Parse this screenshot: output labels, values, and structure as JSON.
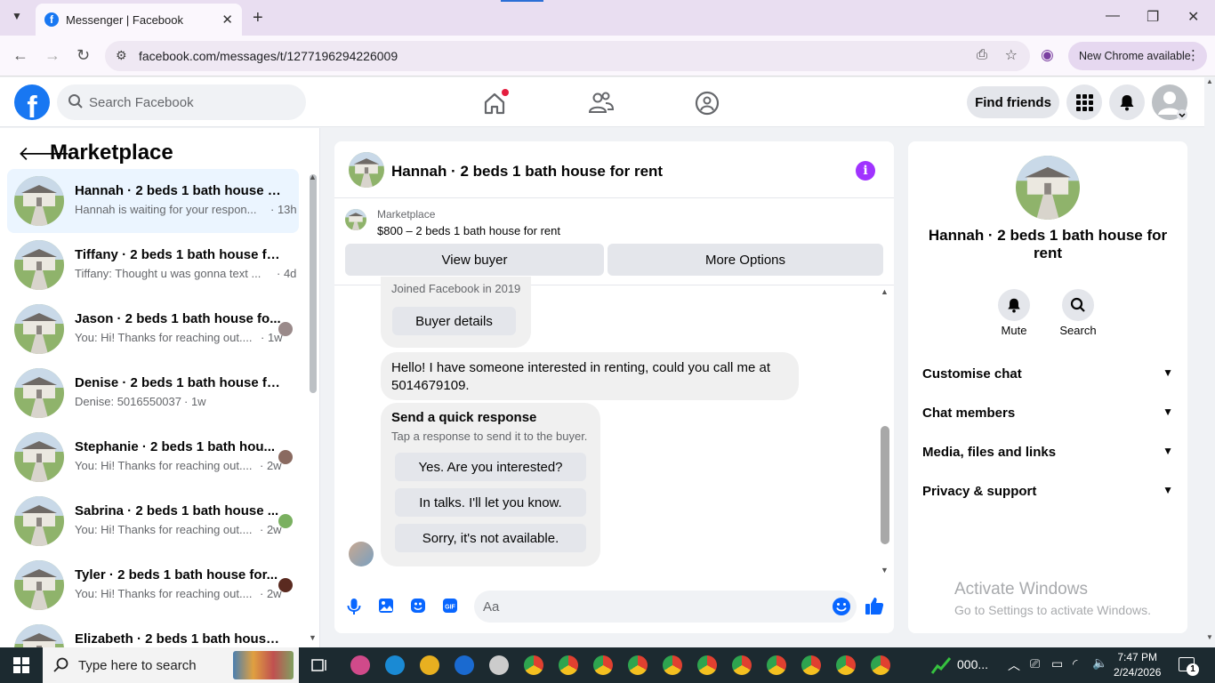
{
  "browser": {
    "tab_title": "Messenger | Facebook",
    "url": "facebook.com/messages/t/1277196294226009",
    "update_label": "New Chrome available"
  },
  "fb": {
    "search_placeholder": "Search Facebook",
    "find_friends": "Find friends"
  },
  "sidebar": {
    "title": "Marketplace",
    "conversations": [
      {
        "name": "Hannah · 2 beds 1 bath house fo...",
        "preview": "Hannah is waiting for your respon...",
        "time": "· 13h",
        "selected": true
      },
      {
        "name": "Tiffany · 2 beds 1 bath house for...",
        "preview": "Tiffany: Thought u was gonna text ...",
        "time": "· 4d"
      },
      {
        "name": "Jason · 2 beds 1 bath house fo...",
        "preview": "You: Hi! Thanks for reaching out....",
        "time": "· 1w"
      },
      {
        "name": "Denise · 2 beds 1 bath house for ...",
        "preview": "Denise: 5016550037",
        "time": "· 1w"
      },
      {
        "name": "Stephanie · 2 beds 1 bath hou...",
        "preview": "You: Hi! Thanks for reaching out....",
        "time": "· 2w"
      },
      {
        "name": "Sabrina · 2 beds 1 bath house ...",
        "preview": "You: Hi! Thanks for reaching out....",
        "time": "· 2w"
      },
      {
        "name": "Tyler · 2 beds 1 bath house for...",
        "preview": "You: Hi! Thanks for reaching out....",
        "time": "· 2w"
      },
      {
        "name": "Elizabeth · 2 beds 1 bath house f...",
        "preview": "",
        "time": ""
      }
    ]
  },
  "chat": {
    "title": "Hannah · 2 beds 1 bath house for rent",
    "marketplace_label": "Marketplace",
    "listing": "$800 – 2 beds 1 bath house for rent",
    "view_buyer": "View buyer",
    "more_options": "More Options",
    "joined": "Joined Facebook in 2019",
    "buyer_details": "Buyer details",
    "message": "Hello! I have someone interested in renting, could you call me at 5014679109.",
    "quick_title": "Send a quick response",
    "quick_sub": "Tap a response to send it to the buyer.",
    "quick_responses": [
      "Yes. Are you interested?",
      "In talks. I'll let you know.",
      "Sorry, it's not available."
    ],
    "composer_placeholder": "Aa"
  },
  "info_panel": {
    "title": "Hannah · 2 beds 1 bath house for rent",
    "mute": "Mute",
    "search": "Search",
    "sections": [
      "Customise chat",
      "Chat members",
      "Media, files and links",
      "Privacy & support"
    ]
  },
  "watermark": {
    "line1": "Activate Windows",
    "line2": "Go to Settings to activate Windows."
  },
  "taskbar": {
    "search_placeholder": "Type here to search",
    "stock": "000...",
    "time": "7:47 PM",
    "date": "2/24/2026",
    "notification_count": "1"
  }
}
